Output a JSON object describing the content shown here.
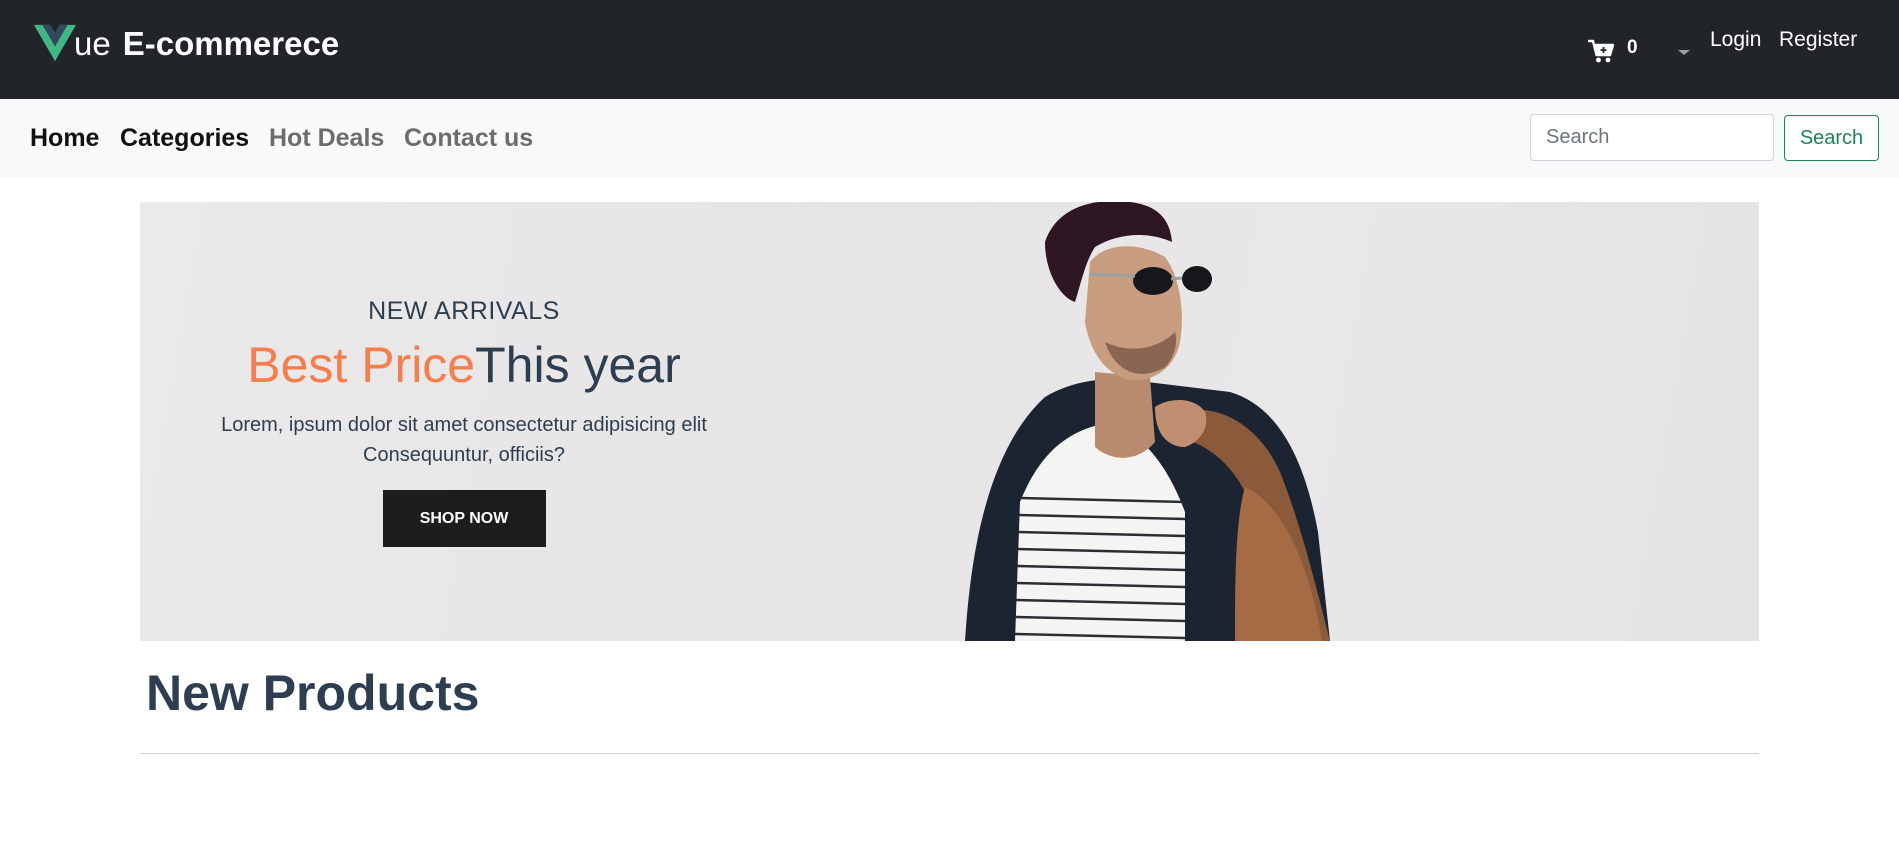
{
  "header": {
    "brand_suffix": "ue",
    "brand_strong": "E-commerece",
    "cart_count": "0",
    "login_label": "Login",
    "register_label": "Register"
  },
  "nav": {
    "items": [
      {
        "label": "Home"
      },
      {
        "label": "Categories"
      },
      {
        "label": "Hot Deals"
      },
      {
        "label": "Contact us"
      }
    ],
    "search": {
      "placeholder": "Search",
      "button_label": "Search"
    }
  },
  "hero": {
    "kicker": "NEW ARRIVALS",
    "headline_accent": "Best Price",
    "headline_main": "This year",
    "description": "Lorem, ipsum dolor sit amet consectetur adipisicing elit Consequuntur, officiis?",
    "button_label": "SHOP NOW"
  },
  "section": {
    "title": "New Products"
  },
  "icons": {
    "logo": "vue-logo-icon",
    "cart": "shopping-cart-icon",
    "dropdown": "caret-down-icon"
  },
  "colors": {
    "topbar_bg": "#212529",
    "navbar_bg": "#f8f9fa",
    "accent_orange": "#f57e4f",
    "heading_navy": "#2c3e50",
    "success_green": "#198754",
    "vue_green": "#42b883",
    "vue_dark": "#35495e"
  }
}
